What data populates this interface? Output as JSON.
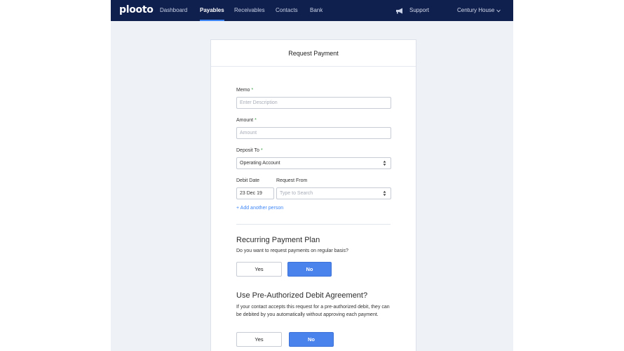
{
  "nav": {
    "logo": "plooto",
    "items": [
      {
        "label": "Dashboard"
      },
      {
        "label": "Payables"
      },
      {
        "label": "Receivables"
      },
      {
        "label": "Contacts"
      },
      {
        "label": "Bank"
      }
    ],
    "active_item": "Payables",
    "support_label": "Support",
    "account_label": "Century House"
  },
  "form": {
    "title": "Request Payment",
    "memo": {
      "label": "Memo",
      "placeholder": "Enter Description",
      "value": ""
    },
    "amount": {
      "label": "Amount",
      "placeholder": "Amount",
      "value": ""
    },
    "deposit_to": {
      "label": "Deposit To",
      "selected": "Operating Account"
    },
    "debit_date": {
      "label": "Debit Date",
      "value": "23 Dec 19"
    },
    "request_from": {
      "label": "Request From",
      "placeholder": "Type to Search"
    },
    "required_marker": "*",
    "add_person_link": "+ Add another person"
  },
  "recurring": {
    "title": "Recurring Payment Plan",
    "question": "Do you want to request payments on regular basis?",
    "yes_label": "Yes",
    "no_label": "No",
    "selected": "No"
  },
  "pad": {
    "title": "Use Pre-Authorized Debit Agreement?",
    "description": "If your contact accepts this request for a pre-authorized debit, they can be debited by you automatically without approving each payment.",
    "yes_label": "Yes",
    "no_label": "No",
    "selected": "No"
  },
  "colors": {
    "navbar": "#0f1f4e",
    "accent": "#4a83ec",
    "required": "#3fa24a",
    "background": "#eef1f5"
  }
}
